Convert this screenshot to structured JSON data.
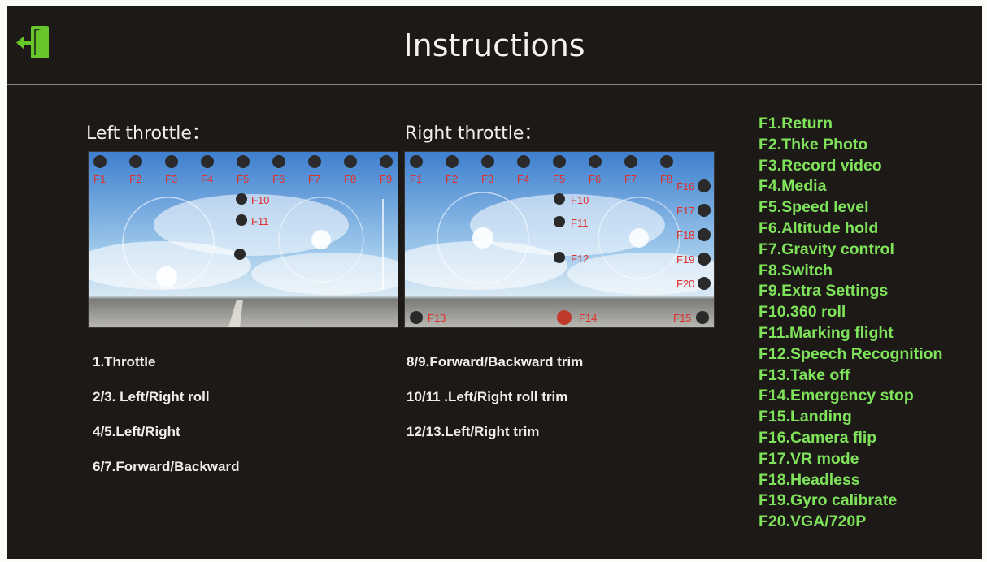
{
  "header": {
    "title": "Instructions",
    "exit_icon": "exit-door-icon"
  },
  "left_panel": {
    "label": "Left throttle：",
    "top_buttons": [
      "F1",
      "F2",
      "F3",
      "F4",
      "F5",
      "F6",
      "F7",
      "F8",
      "F9"
    ],
    "side_buttons": [
      "F10",
      "F11"
    ],
    "legend": [
      "1.Throttle",
      "2/3. Left/Right roll",
      "4/5.Left/Right",
      "6/7.Forward/Backward"
    ]
  },
  "right_panel": {
    "label": "Right throttle：",
    "top_buttons": [
      "F1",
      "F2",
      "F3",
      "F4",
      "F5",
      "F6",
      "F7",
      "F8"
    ],
    "side_buttons": [
      "F10",
      "F11",
      "F12"
    ],
    "right_column": [
      "F16",
      "F17",
      "F18",
      "F19",
      "F20"
    ],
    "bottom_buttons": [
      "F13",
      "F14",
      "F15"
    ],
    "legend": [
      "8/9.Forward/Backward trim",
      "10/11 .Left/Right roll trim",
      "12/13.Left/Right trim"
    ]
  },
  "functions": [
    "F1.Return",
    "F2.Thke Photo",
    "F3.Record video",
    "F4.Media",
    "F5.Speed level",
    "F6.Altitude hold",
    "F7.Gravity control",
    "F8.Switch",
    "F9.Extra Settings",
    "F10.360 roll",
    "F11.Marking flight",
    "F12.Speech Recognition",
    "F13.Take off",
    "F14.Emergency stop",
    "F15.Landing",
    "F16.Camera flip",
    "F17.VR mode",
    "F18.Headless",
    "F19.Gyro calibrate",
    "F20.VGA/720P"
  ],
  "colors": {
    "background": "#1d1916",
    "function_text": "#7ee25a",
    "button_label": "#e0302b",
    "emergency_button": "#c0392b"
  }
}
